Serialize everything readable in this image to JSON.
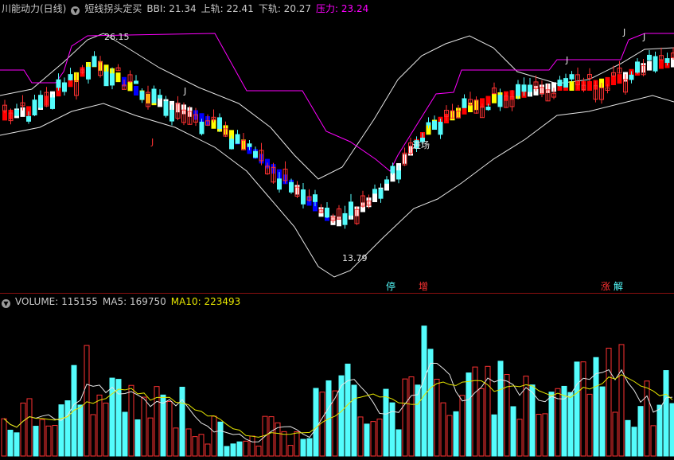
{
  "indicator_header": {
    "name": "川能动力(日线)",
    "formula": "短线拐头定买",
    "bbi": "BBI: 21.34",
    "upper": "上轨: 22.41",
    "lower": "下轨: 20.27",
    "pressure": "压力: 23.24",
    "dropdown_icon": "chevron-down-icon"
  },
  "volume_header": {
    "volume": "VOLUME: 115155",
    "ma5": "MA5: 169750",
    "ma10": "MA10: 223493"
  },
  "price_pane": {
    "high_label": "26.15",
    "low_label": "13.79",
    "breakout_label": "进场",
    "j_marks": [
      "J",
      "J",
      "J",
      "J",
      "J"
    ],
    "event_marks": [
      {
        "text": "停"
      },
      {
        "text": "增"
      },
      {
        "text": "涨"
      },
      {
        "text": "解"
      }
    ]
  },
  "colors": {
    "up": "#ff3232",
    "down": "#54fcfc",
    "pressure": "#ff00ff",
    "bands": "#e6e6e6",
    "ma10": "#e6e600",
    "signal_red": "#ff0000",
    "signal_yellow": "#ffff00",
    "signal_blue": "#0000ff",
    "signal_white": "#ffffff"
  }
}
